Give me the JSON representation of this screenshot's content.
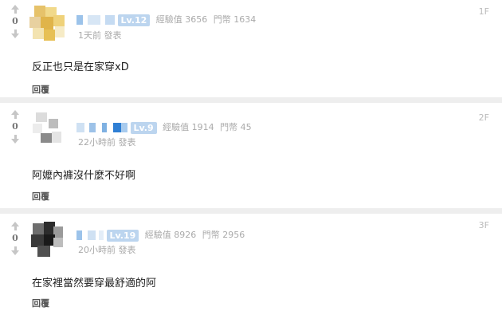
{
  "comments": [
    {
      "floor": "1F",
      "score": "0",
      "level": "Lv.12",
      "exp_label": "經驗值",
      "exp_value": "3656",
      "coin_label": "門幣",
      "coin_value": "1634",
      "time": "1天前 發表",
      "text": "反正也只是在家穿xD",
      "reply": "回覆"
    },
    {
      "floor": "2F",
      "score": "0",
      "level": "Lv.9",
      "exp_label": "經驗值",
      "exp_value": "1914",
      "coin_label": "門幣",
      "coin_value": "45",
      "time": "22小時前 發表",
      "text": "阿嬤內褲沒什麼不好啊",
      "reply": "回覆"
    },
    {
      "floor": "3F",
      "score": "0",
      "level": "Lv.19",
      "exp_label": "經驗值",
      "exp_value": "8926",
      "coin_label": "門幣",
      "coin_value": "2956",
      "time": "20小時前 發表",
      "text": "在家裡當然要穿最舒適的阿",
      "reply": "回覆"
    }
  ],
  "icons": {
    "upvote": "arrow-up-icon",
    "downvote": "arrow-down-icon"
  },
  "colors": {
    "level_badge": "#bcd5ef",
    "separator": "#eeeeee"
  }
}
